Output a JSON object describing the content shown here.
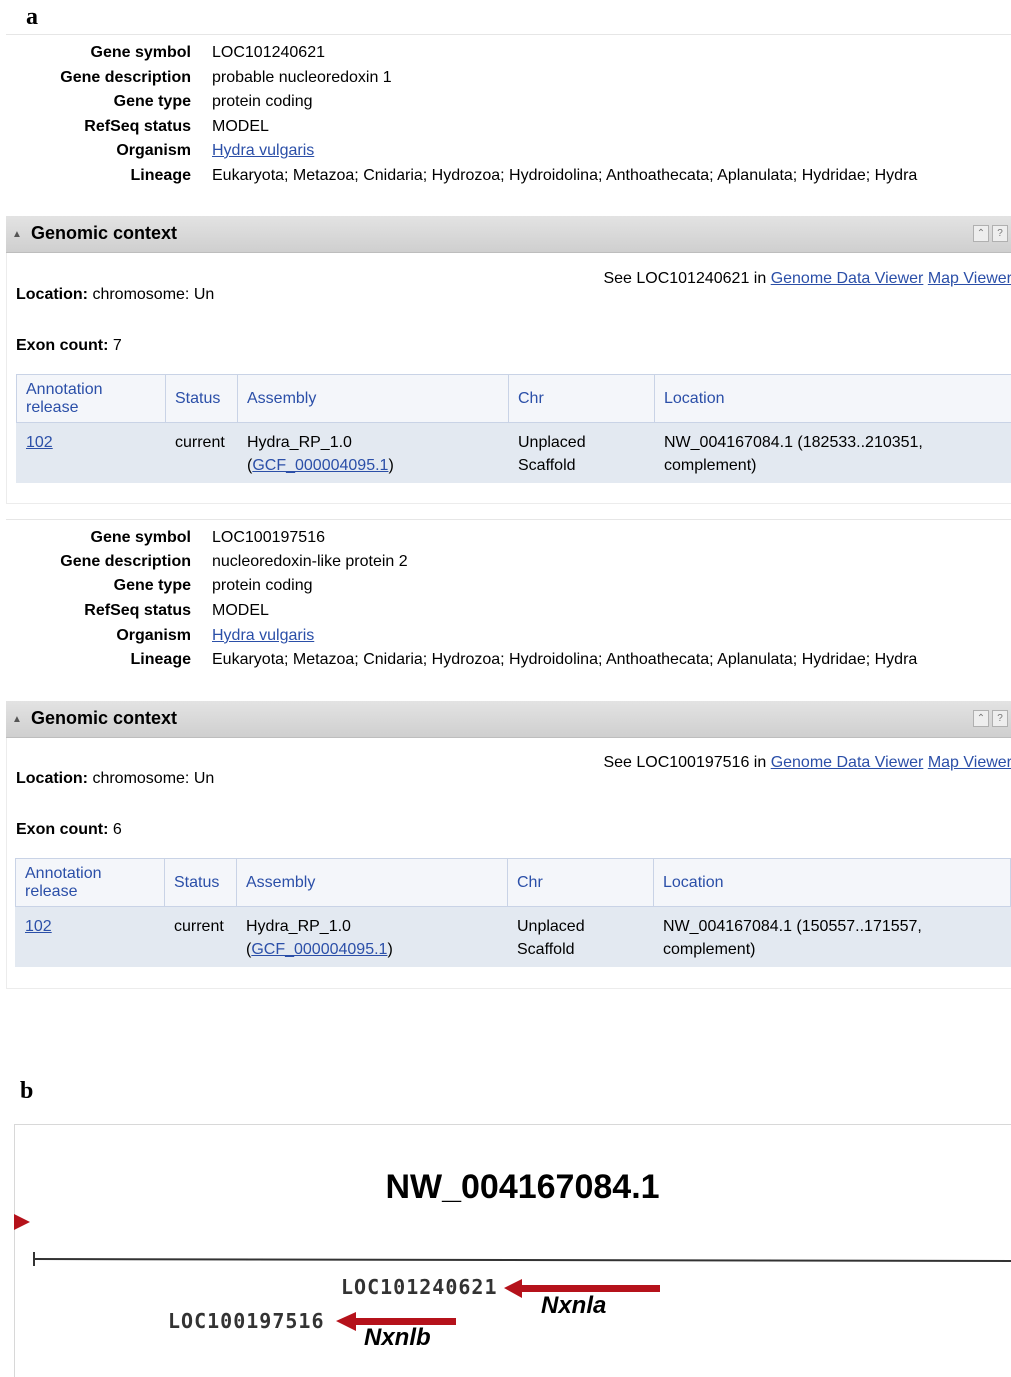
{
  "panels": {
    "a": "a",
    "b": "b"
  },
  "genes": [
    {
      "summary": [
        {
          "label": "Gene symbol",
          "value": "LOC101240621",
          "link": false
        },
        {
          "label": "Gene description",
          "value": "probable nucleoredoxin 1",
          "link": false
        },
        {
          "label": "Gene type",
          "value": "protein coding",
          "link": false
        },
        {
          "label": "RefSeq status",
          "value": "MODEL",
          "link": false
        },
        {
          "label": "Organism",
          "value": "Hydra vulgaris",
          "link": true
        },
        {
          "label": "Lineage",
          "value": "Eukaryota; Metazoa; Cnidaria; Hydrozoa; Hydroidolina; Anthoathecata; Aplanulata; Hydridae; Hydra",
          "link": false
        }
      ],
      "context": {
        "title": "Genomic context",
        "see_prefix": "See LOC101240621 in ",
        "link_gdv": "Genome Data Viewer",
        "link_map": "Map Viewer",
        "location_label": "Location:",
        "location_value": " chromosome: Un",
        "exon_label": "Exon count:",
        "exon_value": " 7",
        "table": {
          "headers": {
            "release": "Annotation release",
            "status": "Status",
            "assembly": "Assembly",
            "chr": "Chr",
            "location": "Location"
          },
          "row": {
            "release": "102",
            "status": "current",
            "assembly_name": "Hydra_RP_1.0",
            "assembly_open": "(",
            "assembly_acc": "GCF_000004095.1",
            "assembly_close": ")",
            "chr_line1": "Unplaced",
            "chr_line2": "Scaffold",
            "loc_line1": "NW_004167084.1 (182533..210351,",
            "loc_line2": "complement)"
          }
        }
      }
    },
    {
      "summary": [
        {
          "label": "Gene symbol",
          "value": "LOC100197516",
          "link": false
        },
        {
          "label": "Gene description",
          "value": "nucleoredoxin-like protein 2",
          "link": false
        },
        {
          "label": "Gene type",
          "value": "protein coding",
          "link": false
        },
        {
          "label": "RefSeq status",
          "value": "MODEL",
          "link": false
        },
        {
          "label": "Organism",
          "value": "Hydra vulgaris",
          "link": true
        },
        {
          "label": "Lineage",
          "value": "Eukaryota; Metazoa; Cnidaria; Hydrozoa; Hydroidolina; Anthoathecata; Aplanulata; Hydridae; Hydra",
          "link": false
        }
      ],
      "context": {
        "title": "Genomic context",
        "see_prefix": "See LOC100197516 in ",
        "link_gdv": "Genome Data Viewer",
        "link_map": "Map Viewer",
        "location_label": "Location:",
        "location_value": " chromosome: Un",
        "exon_label": "Exon count:",
        "exon_value": " 6",
        "table": {
          "headers": {
            "release": "Annotation release",
            "status": "Status",
            "assembly": "Assembly",
            "chr": "Chr",
            "location": "Location"
          },
          "row": {
            "release": "102",
            "status": "current",
            "assembly_name": "Hydra_RP_1.0",
            "assembly_open": "(",
            "assembly_acc": "GCF_000004095.1",
            "assembly_close": ")",
            "chr_line1": "Unplaced",
            "chr_line2": "Scaffold",
            "loc_line1": "NW_004167084.1 (150557..171557,",
            "loc_line2": "complement)"
          }
        }
      }
    }
  ],
  "genome_view": {
    "sequence": "NW_004167084.1",
    "locus_a": "LOC101240621",
    "name_a": "Nxnla",
    "locus_b": "LOC100197516",
    "name_b": "Nxnlb",
    "arrow_color": "#b5121b",
    "link_color": "#2b4fa8"
  },
  "icons": {
    "collapse": "triangle-up-icon",
    "scroll_top": "double-chevron-up-icon",
    "help": "question-icon"
  }
}
